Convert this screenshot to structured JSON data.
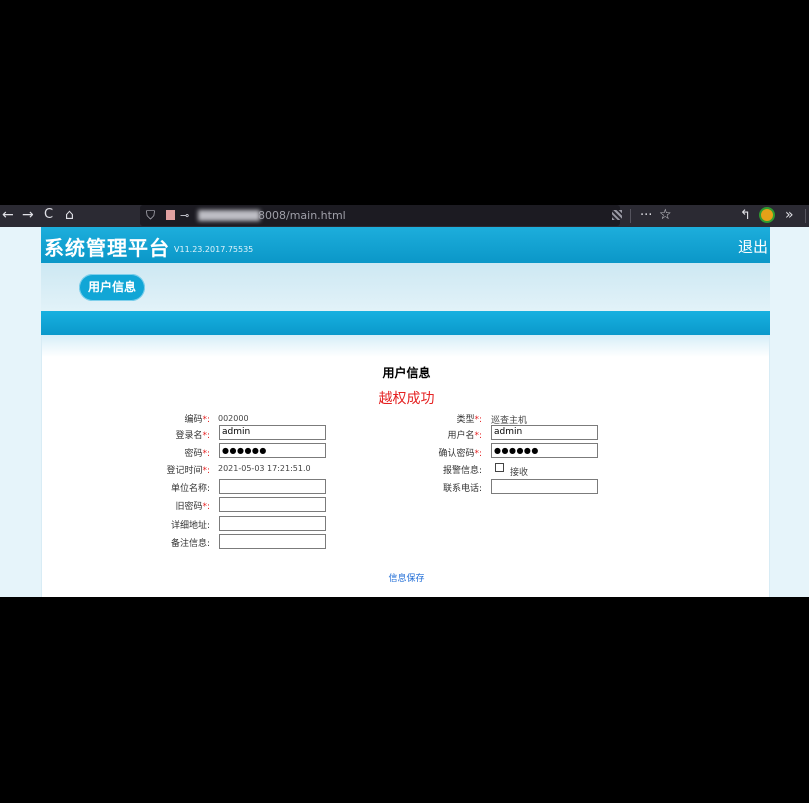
{
  "browser": {
    "url": "8008/main.html",
    "back_glyph": "←",
    "forward_glyph": "→",
    "reload_glyph": "C",
    "home_glyph": "⌂",
    "shield_glyph": "⛉",
    "key_glyph": "⊸",
    "more_glyph": "···",
    "star_glyph": "☆",
    "reply_glyph": "↰",
    "overflow_glyph": "»"
  },
  "app": {
    "title": "系统管理平台",
    "version": "V11.23.2017.75535",
    "logout_label": "退出",
    "tab_label": "用户信息"
  },
  "form": {
    "title": "用户信息",
    "success_message": "越权成功",
    "left": {
      "code_label": "编码",
      "code_value": "002000",
      "login_label": "登录名",
      "login_value": "admin",
      "password_label": "密码",
      "password_value": "●●●●●●",
      "regtime_label": "登记时间",
      "regtime_value": "2021-05-03 17:21:51.0",
      "unit_label": "单位名称:",
      "oldpw_label": "旧密码",
      "address_label": "详细地址:",
      "remark_label": "备注信息:"
    },
    "right": {
      "type_label": "类型",
      "type_value": "巡查主机",
      "username_label": "用户名",
      "username_value": "admin",
      "confirm_label": "确认密码",
      "confirm_value": "●●●●●●",
      "alarm_label": "报警信息:",
      "alarm_option": "接收",
      "phone_label": "联系电话:"
    },
    "required_mark": "*:",
    "save_label": "信息保存"
  },
  "colors": {
    "header_blue": "#0b97c8",
    "error_red": "#e52222",
    "link_blue": "#1d6bd6"
  }
}
